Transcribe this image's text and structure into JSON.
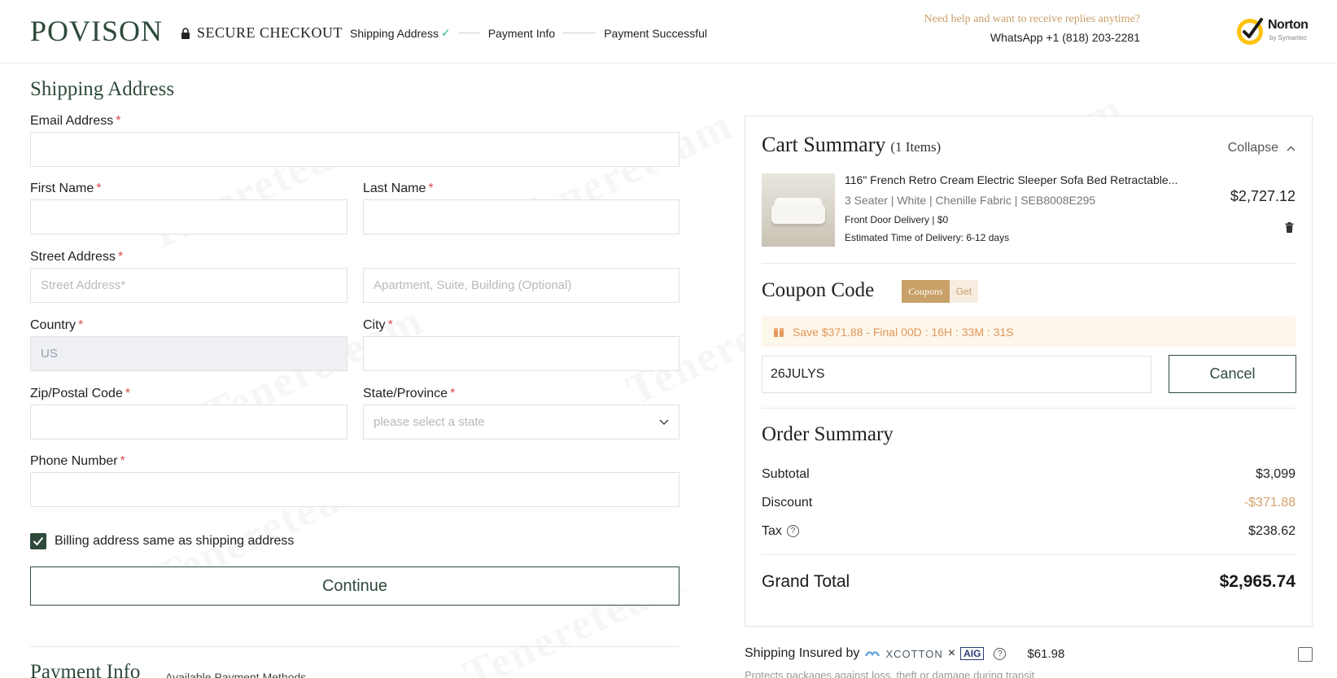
{
  "header": {
    "logo": "POVISON",
    "secure_label": "SECURE CHECKOUT",
    "steps": [
      "Shipping Address",
      "Payment Info",
      "Payment Successful"
    ],
    "step_check": "✓",
    "help_question": "Need help and want to receive replies anytime?",
    "whatsapp": "WhatsApp +1 (818) 203-2281",
    "norton_name": "Norton",
    "norton_sub": "by Symantec"
  },
  "form": {
    "title": "Shipping Address",
    "email_label": "Email Address",
    "first_name_label": "First Name",
    "last_name_label": "Last Name",
    "street_label": "Street Address",
    "street_placeholder": "Street Address*",
    "apt_placeholder": "Apartment, Suite, Building (Optional)",
    "country_label": "Country",
    "country_value": "US",
    "city_label": "City",
    "zip_label": "Zip/Postal Code",
    "state_label": "State/Province",
    "state_placeholder": "please select a state",
    "phone_label": "Phone Number",
    "required_mark": "*",
    "billing_same_label": "Billing address same as shipping address",
    "billing_same_checked": true,
    "continue_label": "Continue"
  },
  "payment": {
    "title": "Payment Info",
    "subtitle": "Available Payment Methods"
  },
  "cart": {
    "title": "Cart Summary",
    "count": "(1 Items)",
    "collapse_label": "Collapse",
    "item": {
      "title": "116\" French Retro Cream Electric Sleeper Sofa Bed Retractable...",
      "specs": "3 Seater  |  White  |  Chenille Fabric  |  SEB8008E295",
      "delivery": "Front Door Delivery | $0",
      "eta": "Estimated Time of Delivery: 6-12 days",
      "price": "$2,727.12"
    },
    "coupon": {
      "title": "Coupon Code",
      "badge_left": "Coupons",
      "badge_right": "Get",
      "save_text": "Save $371.88 - Final  00D :  16H  :  33M :  31S",
      "code_value": "26JULYS",
      "cancel_label": "Cancel"
    },
    "order": {
      "title": "Order Summary",
      "subtotal_label": "Subtotal",
      "subtotal_value": "$3,099",
      "discount_label": "Discount",
      "discount_value": "-$371.88",
      "tax_label": "Tax",
      "tax_help": "?",
      "tax_value": "$238.62",
      "grand_label": "Grand Total",
      "grand_value": "$2,965.74"
    }
  },
  "insurance": {
    "label": "Shipping Insured by",
    "provider": "XCOTTON",
    "times": "×",
    "partner": "AIG",
    "help": "?",
    "price": "$61.98",
    "note": "Protects packages against loss, theft or damage during transit",
    "checked": false
  },
  "watermark": "Tenereteam",
  "colors": {
    "brand_green": "#2f4a3a",
    "accent_gold": "#c8a068",
    "required_red": "#d94b4b",
    "check_green": "#2dbb7d"
  }
}
